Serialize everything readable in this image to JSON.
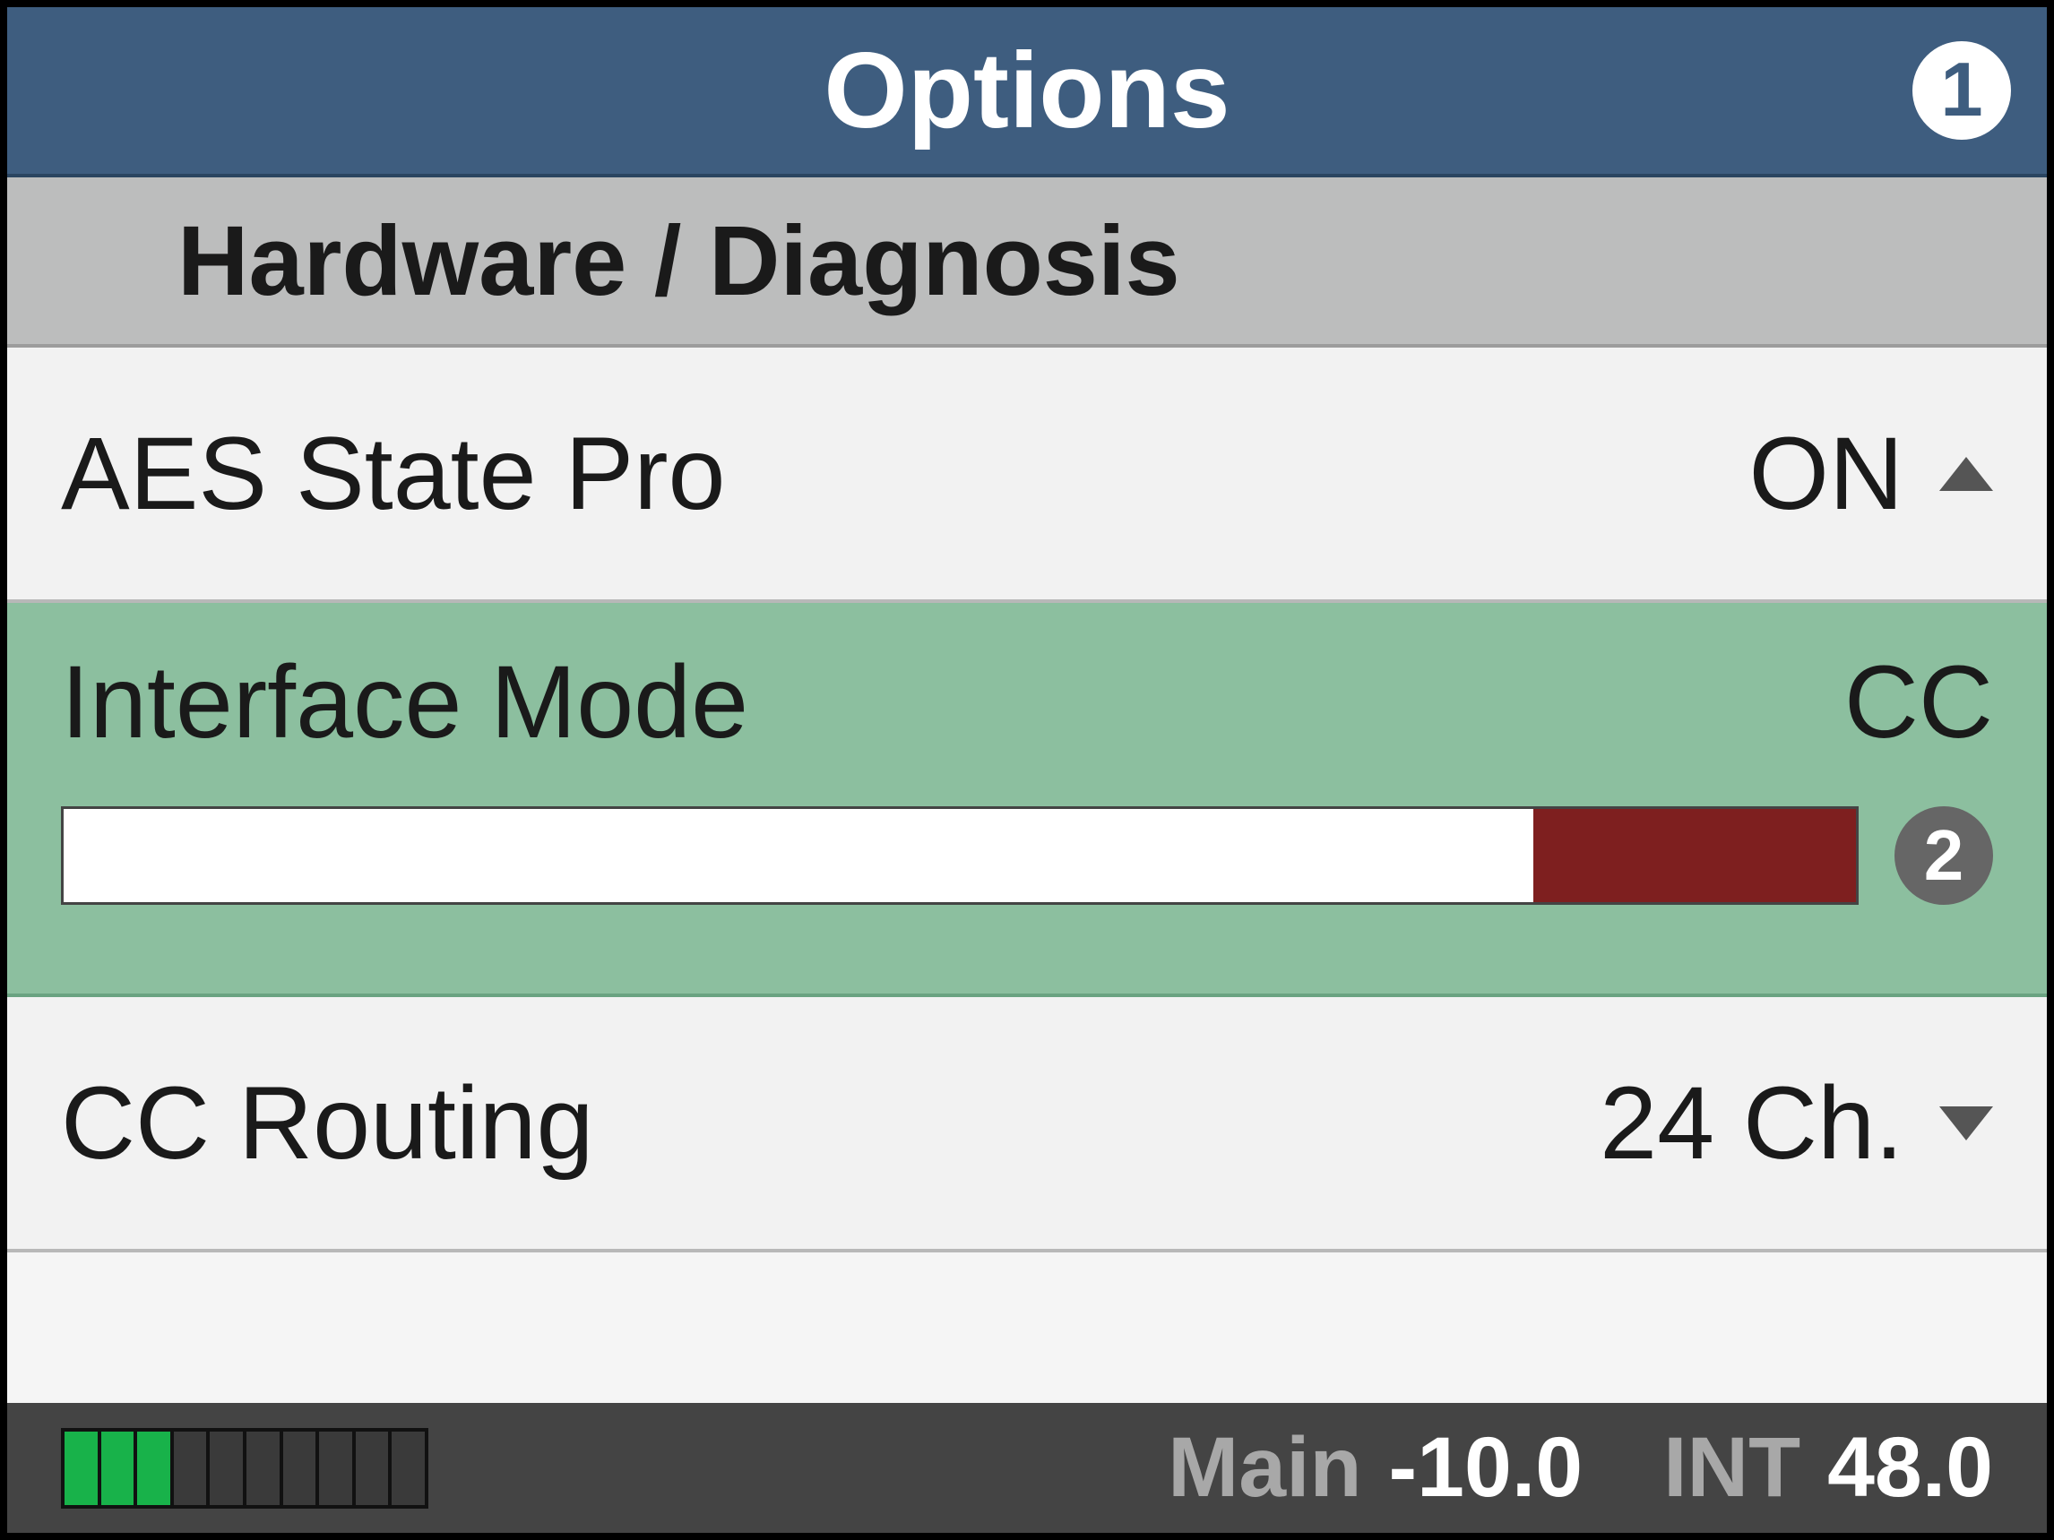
{
  "header": {
    "title": "Options",
    "badge": "1"
  },
  "section": {
    "title": "Hardware / Diagnosis"
  },
  "rows": [
    {
      "label": "AES State Pro",
      "value": "ON",
      "arrow": "up"
    },
    {
      "label": "Interface Mode",
      "value": "CC",
      "badge": "2",
      "slider_fill_pct": 18
    },
    {
      "label": "CC Routing",
      "value": "24 Ch.",
      "arrow": "down"
    }
  ],
  "footer": {
    "meter_segments": 10,
    "meter_active": 3,
    "main_label": "Main",
    "main_value": "-10.0",
    "clock_label": "INT",
    "clock_value": "48.0"
  }
}
